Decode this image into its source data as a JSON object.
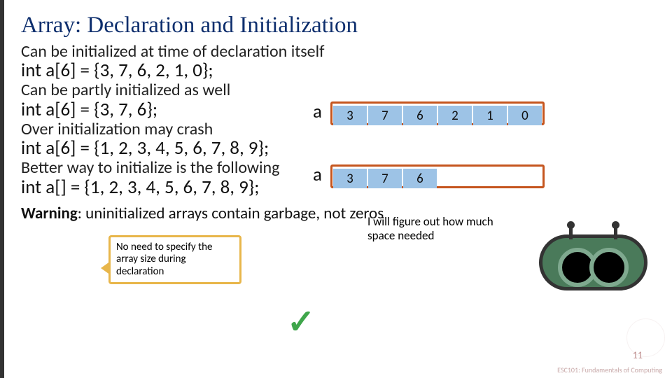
{
  "title": "Array: Declaration and Initialization",
  "lines": {
    "l1": "Can be initialized at time of declaration itself",
    "code1": "int a[6] = {3, 7, 6, 2, 1, 0};",
    "l2": "Can be partly initialized as well",
    "code2": "int a[6] = {3, 7, 6};",
    "l3": "Over initialization may crash",
    "code3": "int a[6] = {1, 2, 3, 4, 5, 6, 7, 8, 9};",
    "l4": "Better way to initialize is the following",
    "code4": "int a[] = {1, 2, 3, 4, 5, 6, 7, 8, 9};",
    "warning_label": "Warning",
    "warning_text": ": uninitialized arrays contain garbage, not zeros"
  },
  "array_label": "a",
  "array1": {
    "cells": [
      "3",
      "7",
      "6",
      "2",
      "1",
      "0"
    ]
  },
  "array2": {
    "cells": [
      "3",
      "7",
      "6",
      "",
      "",
      ""
    ]
  },
  "callout1": "No need to specify the array size during declaration",
  "callout2": "I will figure out how much space needed",
  "page_number": "11",
  "course": "ESC101: Fundamentals\nof Computing",
  "checkmark": "✓"
}
